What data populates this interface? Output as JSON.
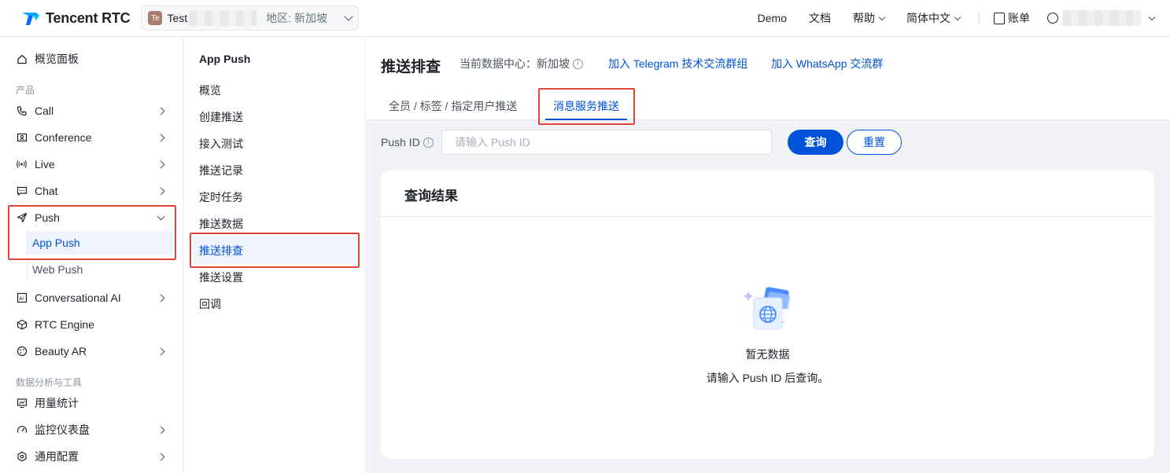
{
  "header": {
    "brand": "Tencent RTC",
    "app": {
      "avatar": "Te",
      "name": "Test",
      "region": "地区: 新加坡"
    },
    "links": [
      "Demo",
      "文档",
      "帮助",
      "简体中文"
    ],
    "billing": "账单"
  },
  "sidebar": {
    "overview": "概览面板",
    "section_products": "产品",
    "items": [
      {
        "label": "Call",
        "icon": "phone-icon"
      },
      {
        "label": "Conference",
        "icon": "conference-icon"
      },
      {
        "label": "Live",
        "icon": "broadcast-icon"
      },
      {
        "label": "Chat",
        "icon": "chat-icon"
      },
      {
        "label": "Push",
        "icon": "send-icon"
      }
    ],
    "push_sub": [
      "App Push",
      "Web Push"
    ],
    "items2": [
      {
        "label": "Conversational AI",
        "icon": "ai-icon"
      },
      {
        "label": "RTC Engine",
        "icon": "cube-icon"
      },
      {
        "label": "Beauty AR",
        "icon": "palette-icon"
      }
    ],
    "section_tools": "数据分析与工具",
    "tools": [
      {
        "label": "用量统计",
        "icon": "monitor-icon"
      },
      {
        "label": "监控仪表盘",
        "icon": "gauge-icon"
      },
      {
        "label": "通用配置",
        "icon": "settings-icon"
      }
    ]
  },
  "subnav": {
    "title": "App Push",
    "items": [
      "概览",
      "创建推送",
      "接入测试",
      "推送记录",
      "定时任务",
      "推送数据",
      "推送排查",
      "推送设置",
      "回调"
    ],
    "active_index": 6
  },
  "main": {
    "title": "推送排查",
    "datacenter": "当前数据中心：新加坡",
    "link_telegram": "加入 Telegram 技术交流群组",
    "link_whatsapp": "加入 WhatsApp 交流群",
    "tabs": [
      "全员 / 标签 / 指定用户推送",
      "消息服务推送"
    ],
    "active_tab": 1,
    "query": {
      "label": "Push ID",
      "placeholder": "请输入 Push ID",
      "value": "",
      "search_button": "查询",
      "reset_button": "重置"
    },
    "result": {
      "title": "查询结果",
      "empty_title": "暂无数据",
      "empty_desc": "请输入 Push ID 后查询。"
    }
  },
  "colors": {
    "primary": "#0052d9",
    "highlight_box": "#e1453a",
    "page_bg": "#f1f2f5"
  }
}
